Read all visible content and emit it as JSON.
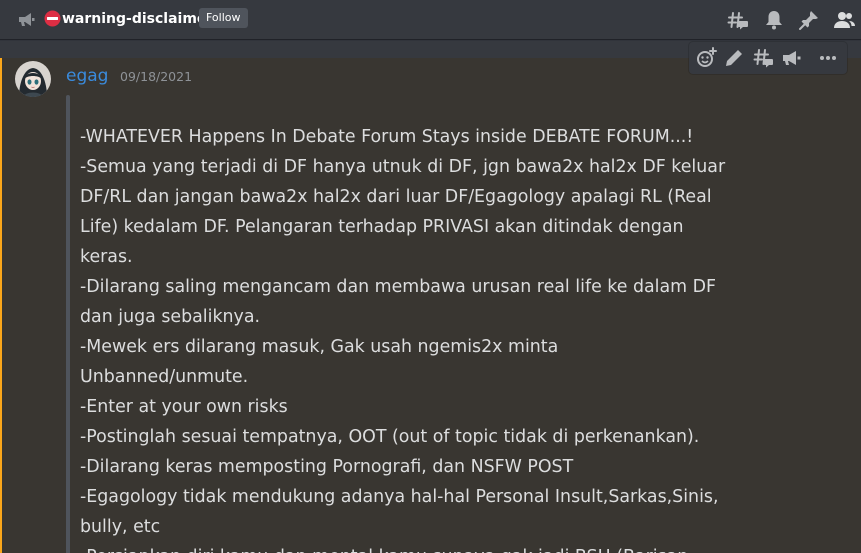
{
  "header": {
    "channel_type_icon": "announcement-megaphone-icon",
    "channel_emoji": "no-entry-icon",
    "channel_name": "warning-disclaimer",
    "follow_label": "Follow",
    "tools": [
      "threads-icon",
      "notification-bell-icon",
      "pin-icon",
      "member-list-icon"
    ]
  },
  "message": {
    "author": "egag",
    "timestamp": "09/18/2021",
    "author_color": "#3a8bdc",
    "mention_color": "#faa61a",
    "lines": [
      "-WHATEVER Happens In Debate Forum Stays inside DEBATE FORUM...!",
      "-Semua yang terjadi di DF hanya utnuk di DF, jgn bawa2x hal2x DF keluar",
      "DF/RL dan jangan bawa2x hal2x dari luar DF/Egagology apalagi RL (Real",
      "Life) kedalam DF. Pelangaran terhadap PRIVASI akan ditindak dengan",
      "keras.",
      "-Dilarang saling mengancam dan membawa urusan real life ke dalam DF",
      "dan juga sebaliknya.",
      "-Mewek ers dilarang masuk, Gak usah ngemis2x minta",
      "Unbanned/unmute.",
      "-Enter at your own risks",
      "-Postinglah sesuai tempatnya, OOT (out of topic tidak di perkenankan).",
      "-Dilarang keras memposting Pornografi, dan NSFW POST",
      "-Egagology tidak mendukung adanya hal-hal Personal Insult,Sarkas,Sinis,",
      "bully, etc",
      "-Persiapkan diri kamu dan mental kamu supaya gak jadi BSH (Barisan"
    ]
  },
  "toolbar": {
    "buttons": [
      "add-reaction-icon",
      "edit-pencil-icon",
      "create-thread-icon",
      "publish-megaphone-icon",
      "more-options-icon"
    ]
  }
}
